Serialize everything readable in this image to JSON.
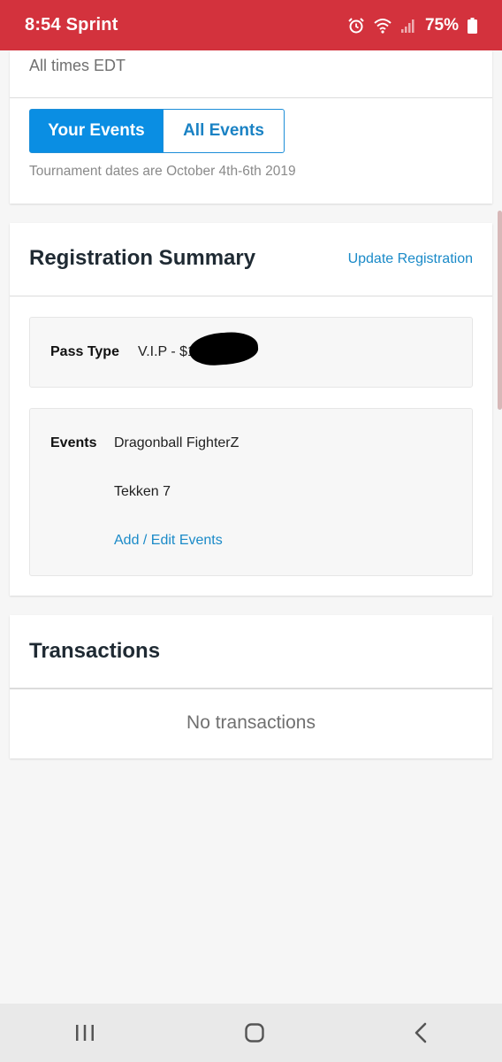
{
  "status_bar": {
    "time": "8:54",
    "carrier": "Sprint",
    "battery": "75%",
    "icons": [
      "alarm-icon",
      "wifi-icon",
      "signal-icon",
      "battery-icon"
    ]
  },
  "schedule": {
    "timezone_note": "All times EDT",
    "tabs": [
      {
        "label": "Your Events",
        "active": true
      },
      {
        "label": "All Events",
        "active": false
      }
    ],
    "dates_note": "Tournament dates are October 4th-6th 2019"
  },
  "registration": {
    "title": "Registration Summary",
    "update_link": "Update Registration",
    "pass_type_label": "Pass Type",
    "pass_type_value": "V.I.P - $1",
    "events_label": "Events",
    "events": [
      "Dragonball FighterZ",
      "Tekken 7"
    ],
    "edit_link": "Add / Edit Events"
  },
  "transactions": {
    "title": "Transactions",
    "empty_text": "No transactions"
  },
  "nav_bar": {
    "icons": [
      "recent-apps-icon",
      "home-icon",
      "back-icon"
    ]
  },
  "colors": {
    "status_bar": "#d3323d",
    "accent": "#0a8ee3",
    "link": "#1a8ac8"
  }
}
